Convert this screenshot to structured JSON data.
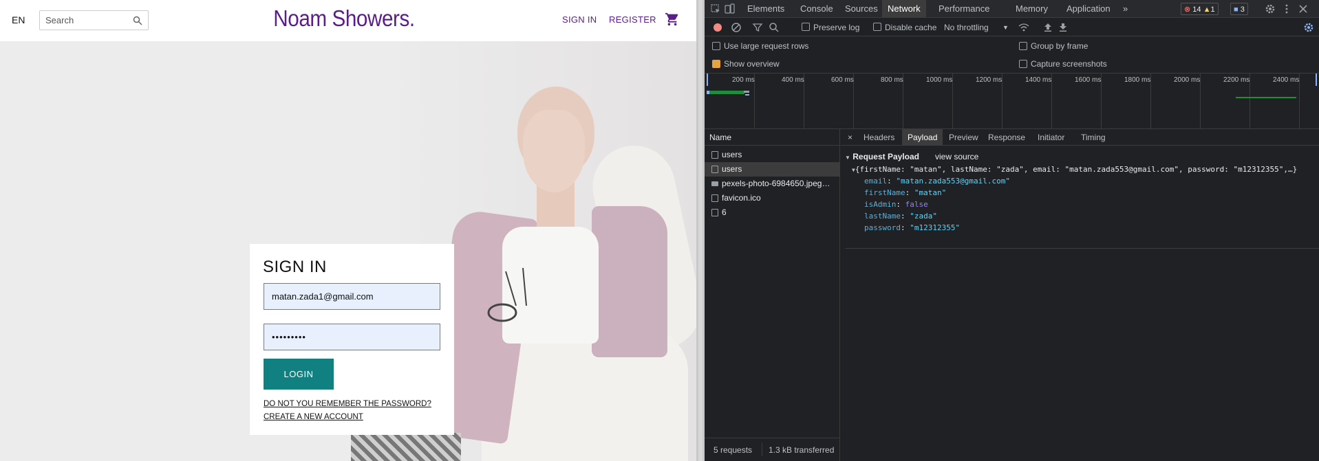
{
  "site": {
    "language": "EN",
    "search_placeholder": "Search",
    "brand": "Noam Showers.",
    "nav_signin": "SIGN IN",
    "nav_register": "REGISTER",
    "login": {
      "title": "SIGN IN",
      "email_value": "matan.zada1@gmail.com",
      "password_value": "•••••••••",
      "button_label": "LOGIN",
      "help_link": "DO NOT YOU REMEMBER THE PASSWORD?CREATE A NEW ACCOUNT"
    },
    "accent_color": "#5b1d8a",
    "button_color": "#118080"
  },
  "devtools": {
    "tabs": [
      "Elements",
      "Console",
      "Sources",
      "Network",
      "Performance",
      "Memory",
      "Application"
    ],
    "active_tab": "Network",
    "errors_count": "14",
    "warnings_count": "1",
    "messages_count": "3",
    "toolbar": {
      "preserve_log": "Preserve log",
      "disable_cache": "Disable cache",
      "throttling": "No throttling"
    },
    "settings": {
      "large_rows": "Use large request rows",
      "show_overview": "Show overview",
      "group_by_frame": "Group by frame",
      "capture_screenshots": "Capture screenshots"
    },
    "overview_ticks": [
      "200 ms",
      "400 ms",
      "600 ms",
      "800 ms",
      "1000 ms",
      "1200 ms",
      "1400 ms",
      "1600 ms",
      "1800 ms",
      "2000 ms",
      "2200 ms",
      "2400 ms"
    ],
    "list_header": "Name",
    "requests": [
      "users",
      "users",
      "pexels-photo-6984650.jpeg…",
      "favicon.ico",
      "6"
    ],
    "summary_requests": "5 requests",
    "summary_transferred": "1.3 kB transferred",
    "detail_tabs": [
      "Headers",
      "Payload",
      "Preview",
      "Response",
      "Initiator",
      "Timing"
    ],
    "active_detail_tab": "Payload",
    "payload": {
      "section_title": "Request Payload",
      "view_source": "view source",
      "summary": "{firstName: \"matan\", lastName: \"zada\", email: \"matan.zada553@gmail.com\", password: \"m12312355\",…}",
      "fields": [
        {
          "key": "email",
          "value": "\"matan.zada553@gmail.com\"",
          "type": "string"
        },
        {
          "key": "firstName",
          "value": "\"matan\"",
          "type": "string"
        },
        {
          "key": "isAdmin",
          "value": "false",
          "type": "bool"
        },
        {
          "key": "lastName",
          "value": "\"zada\"",
          "type": "string"
        },
        {
          "key": "password",
          "value": "\"m12312355\"",
          "type": "string"
        }
      ]
    }
  }
}
